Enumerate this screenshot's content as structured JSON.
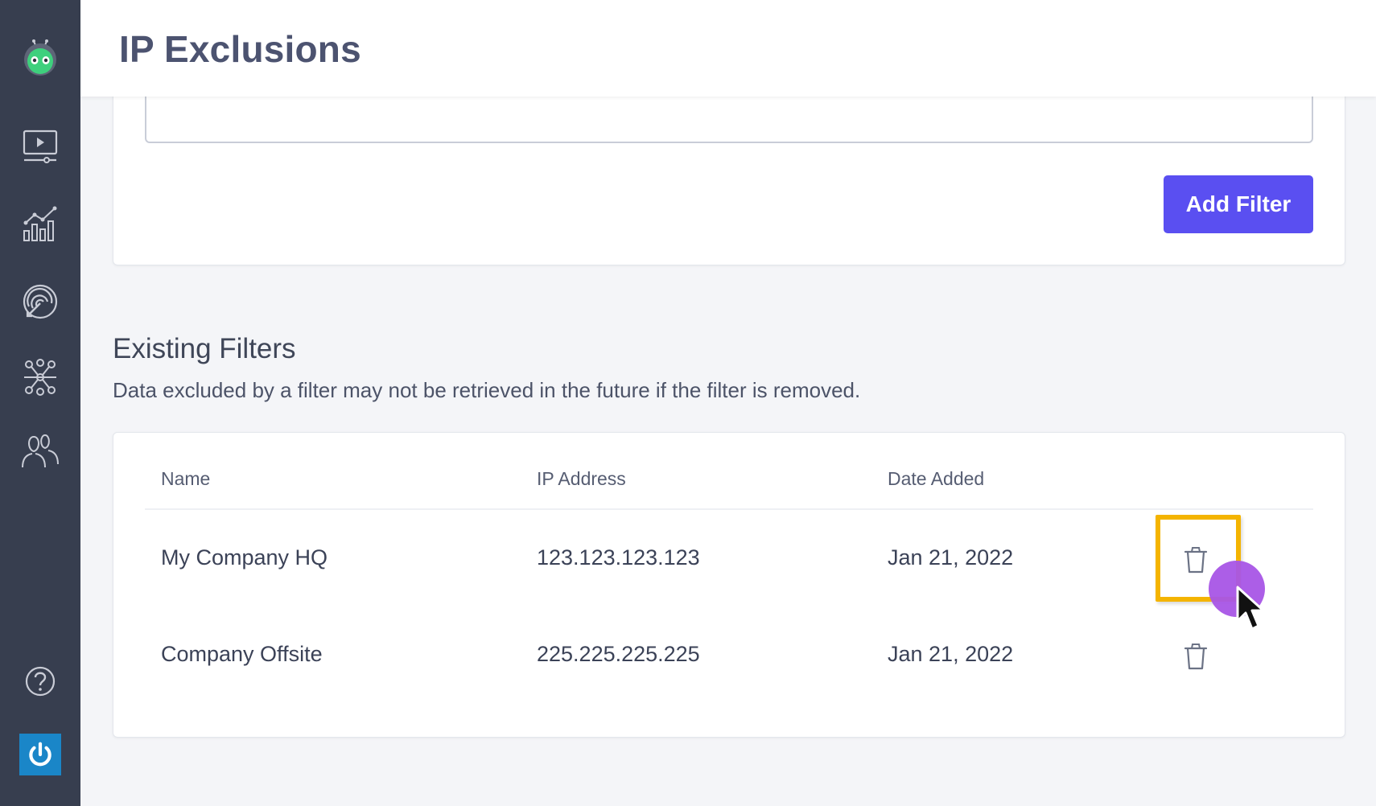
{
  "header": {
    "title": "IP Exclusions"
  },
  "sidebar": {
    "items": [
      {
        "name": "video",
        "icon": "video-player-icon"
      },
      {
        "name": "analytics",
        "icon": "chart-icon"
      },
      {
        "name": "targeting",
        "icon": "fingerprint-target-icon"
      },
      {
        "name": "integrations",
        "icon": "network-icon"
      },
      {
        "name": "users",
        "icon": "users-icon"
      }
    ],
    "help_icon": "help-icon",
    "power_icon": "power-icon"
  },
  "filter_form": {
    "add_button_label": "Add Filter",
    "input_value": ""
  },
  "existing_filters": {
    "title": "Existing Filters",
    "description": "Data excluded by a filter may not be retrieved in the future if the filter is removed.",
    "columns": [
      "Name",
      "IP Address",
      "Date Added"
    ],
    "rows": [
      {
        "name": "My Company HQ",
        "ip": "123.123.123.123",
        "date": "Jan 21, 2022"
      },
      {
        "name": "Company Offsite",
        "ip": "225.225.225.225",
        "date": "Jan 21, 2022"
      }
    ]
  },
  "colors": {
    "sidebar": "#373e4f",
    "accent": "#5a4ff1",
    "highlight": "#f4b400",
    "click_indicator": "#a855e6",
    "power_button": "#1a86c8"
  }
}
